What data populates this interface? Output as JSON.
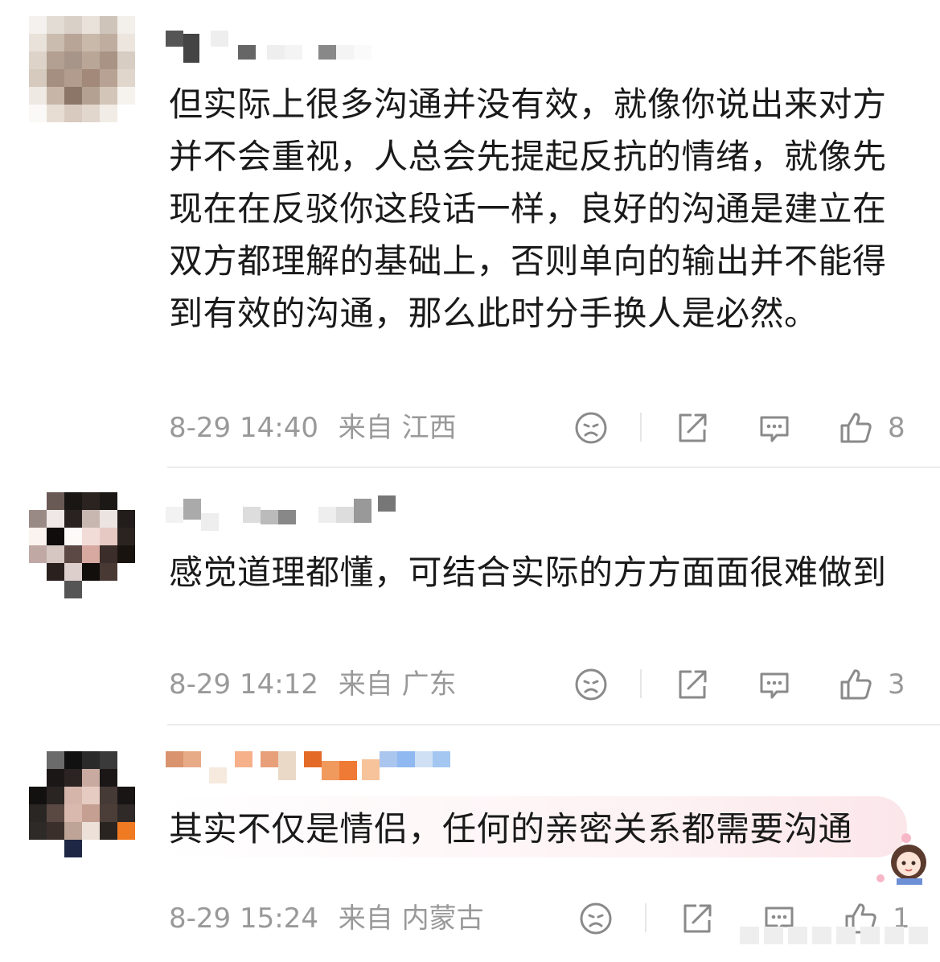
{
  "comments": [
    {
      "text": "但实际上很多沟通并没有效，就像你说出来对方并不会重视，人总会先提起反抗的情绪，就像先现在在反驳你这段话一样，良好的沟通是建立在双方都理解的基础上，否则单向的输出并不能得到有效的沟通，那么此时分手换人是必然。",
      "time": "8-29 14:40",
      "source_prefix": "来自",
      "location": "江西",
      "likes": "8"
    },
    {
      "text": "感觉道理都懂，可结合实际的方方面面很难做到",
      "time": "8-29 14:12",
      "source_prefix": "来自",
      "location": "广东",
      "likes": "3"
    },
    {
      "text": "其实不仅是情侣，任何的亲密关系都需要沟通",
      "time": "8-29 15:24",
      "source_prefix": "来自",
      "location": "内蒙古",
      "likes": "1"
    }
  ],
  "icons": {
    "dislike": "sad-face-icon",
    "share": "share-icon",
    "reply": "comment-bubble-icon",
    "like": "thumbs-up-icon"
  },
  "colors": {
    "text": "#1a1a1a",
    "meta": "#999999",
    "icon": "#8a8a8a",
    "divider": "#ececec",
    "highlight": "#fbe6ea"
  }
}
